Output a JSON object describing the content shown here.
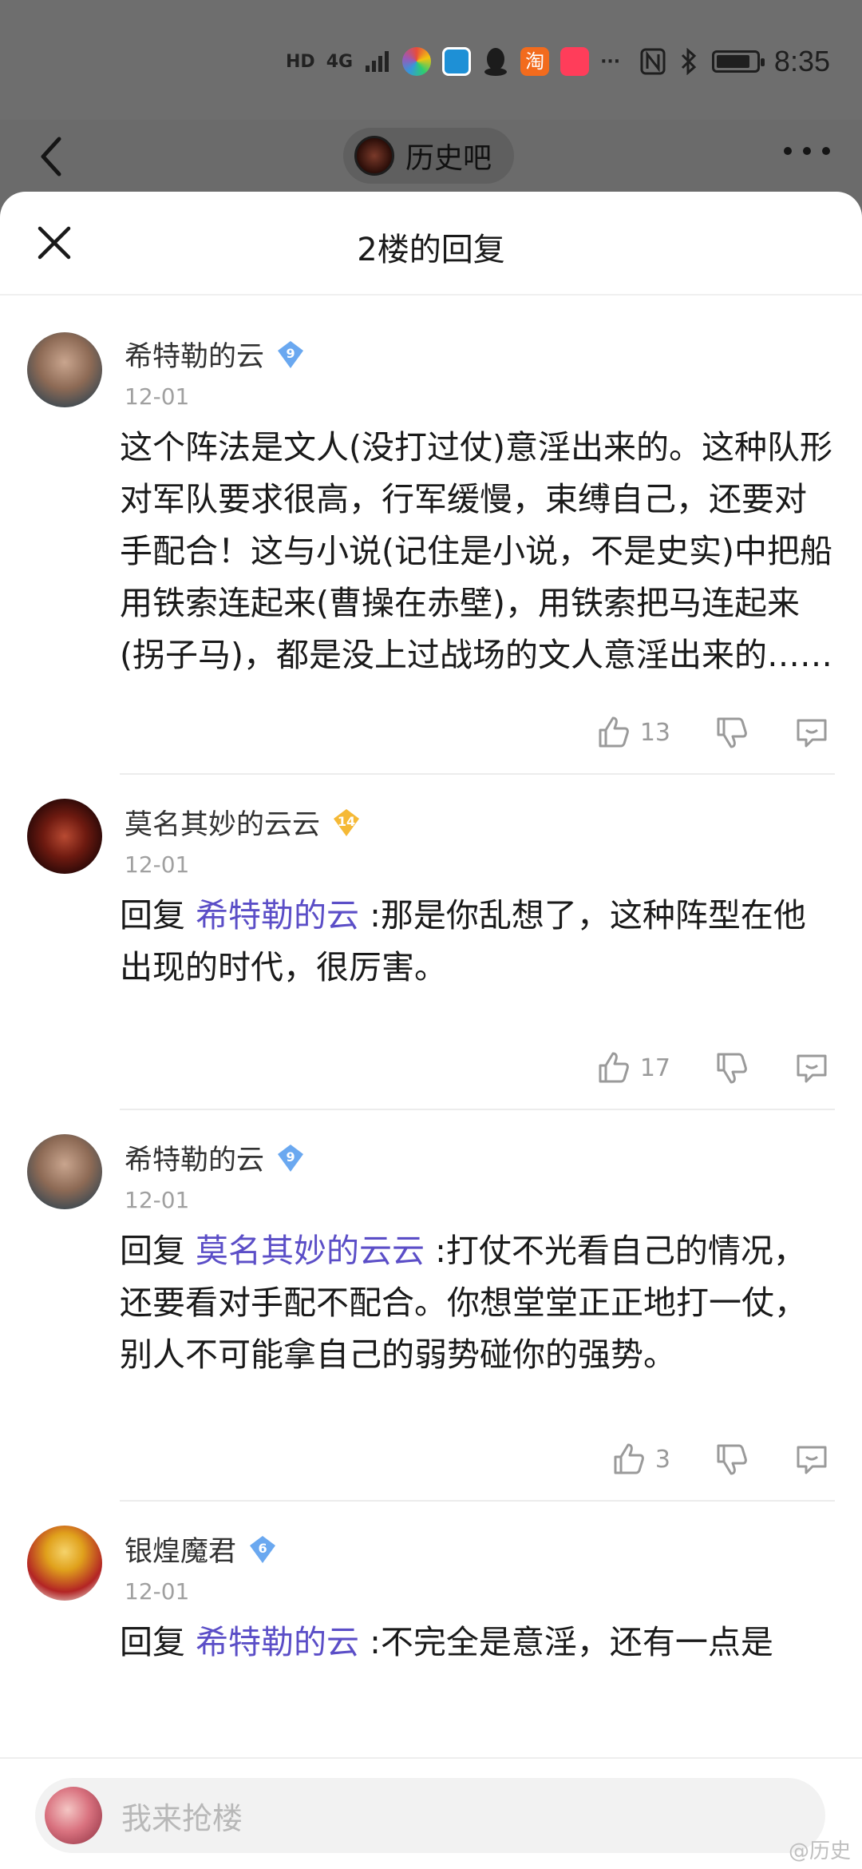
{
  "status_bar": {
    "network": "HD",
    "signal": "4G",
    "time": "8:35",
    "battery_level": 0.85,
    "app_icons": [
      "colorful-app-icon",
      "browser-app-icon",
      "qq-icon",
      "taobao-icon",
      "tmall-icon"
    ],
    "taobao_label": "淘",
    "more": "···"
  },
  "nav": {
    "forum_name": "历史吧"
  },
  "sheet": {
    "title": "2楼的回复"
  },
  "replies": [
    {
      "username": "希特勒的云",
      "level": "9",
      "date": "12-01",
      "reply_prefix": "",
      "mention": "",
      "text": "这个阵法是文人(没打过仗)意淫出来的。这种队形对军队要求很高，行军缓慢，束缚自己，还要对手配合！这与小说(记住是小说，不是史实)中把船用铁索连起来(曹操在赤壁)，用铁索把马连起来(拐子马)，都是没上过战场的文人意淫出来的……",
      "likes": "13"
    },
    {
      "username": "莫名其妙的云云",
      "level": "14",
      "date": "12-01",
      "reply_prefix": "回复 ",
      "mention": "希特勒的云",
      "text": " :那是你乱想了，这种阵型在他出现的时代，很厉害。",
      "likes": "17"
    },
    {
      "username": "希特勒的云",
      "level": "9",
      "date": "12-01",
      "reply_prefix": "回复 ",
      "mention": "莫名其妙的云云",
      "text": " :打仗不光看自己的情况，还要看对手配不配合。你想堂堂正正地打一仗，别人不可能拿自己的弱势碰你的强势。",
      "likes": "3"
    },
    {
      "username": "银煌魔君",
      "level": "6",
      "date": "12-01",
      "reply_prefix": "回复 ",
      "mention": "希特勒的云",
      "text": " :不完全是意淫，还有一点是",
      "likes": ""
    }
  ],
  "input": {
    "placeholder": "我来抢楼"
  },
  "watermark": "@历史"
}
